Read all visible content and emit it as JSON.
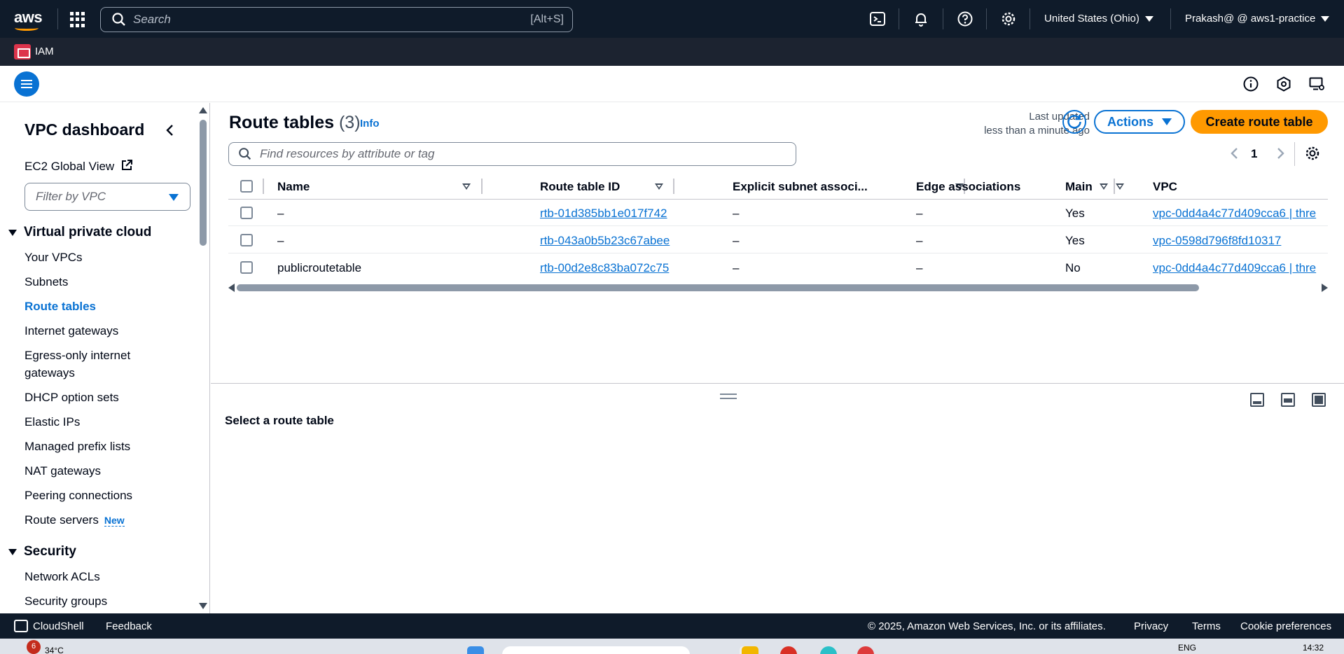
{
  "topnav": {
    "logo_text": "aws",
    "search_placeholder": "Search",
    "search_shortcut": "[Alt+S]",
    "region": "United States (Ohio)",
    "account": "Prakash@ @ aws1-practice",
    "icons": [
      "cloudshell-icon",
      "bell-icon",
      "help-icon",
      "settings-icon"
    ]
  },
  "servicebar": {
    "service": "IAM"
  },
  "sidebar": {
    "title": "VPC dashboard",
    "ec2_link": "EC2 Global View",
    "filter_placeholder": "Filter by VPC",
    "section_vpc": "Virtual private cloud",
    "vpc_items": [
      "Your VPCs",
      "Subnets",
      "Route tables",
      "Internet gateways",
      "Egress-only internet",
      "gateways",
      "DHCP option sets",
      "Elastic IPs",
      "Managed prefix lists",
      "NAT gateways",
      "Peering connections",
      "Route servers"
    ],
    "new_badge": "New",
    "section_security": "Security",
    "security_items": [
      "Network ACLs",
      "Security groups"
    ]
  },
  "main": {
    "title": "Route tables",
    "count": "(3)",
    "info": "Info",
    "last_updated_line1": "Last updated",
    "last_updated_line2": "less than a minute ago",
    "actions_label": "Actions",
    "create_label": "Create route table",
    "find_placeholder": "Find resources by attribute or tag",
    "page_number": "1",
    "columns": [
      "Name",
      "Route table ID",
      "Explicit subnet associ...",
      "Edge associations",
      "Main",
      "VPC"
    ],
    "rows": [
      {
        "name": "–",
        "id": "rtb-01d385bb1e017f742",
        "explicit": "–",
        "edge": "–",
        "main": "Yes",
        "vpc": "vpc-0dd4a4c77d409cca6 | thre"
      },
      {
        "name": "–",
        "id": "rtb-043a0b5b23c67abee",
        "explicit": "–",
        "edge": "–",
        "main": "Yes",
        "vpc": "vpc-0598d796f8fd10317"
      },
      {
        "name": "publicroutetable",
        "id": "rtb-00d2e8c83ba072c75",
        "explicit": "–",
        "edge": "–",
        "main": "No",
        "vpc": "vpc-0dd4a4c77d409cca6 | thre"
      }
    ],
    "split_title": "Select a route table"
  },
  "footer": {
    "cloudshell": "CloudShell",
    "feedback": "Feedback",
    "copyright": "© 2025, Amazon Web Services, Inc. or its affiliates.",
    "privacy": "Privacy",
    "terms": "Terms",
    "cookies": "Cookie preferences"
  },
  "taskbar": {
    "temp": "34°C",
    "badge": "6",
    "lang": "ENG",
    "time": "14:32"
  },
  "colors": {
    "nav_bg": "#0f1b2a",
    "link_blue": "#0972d3",
    "primary_orange": "#ff9900"
  }
}
